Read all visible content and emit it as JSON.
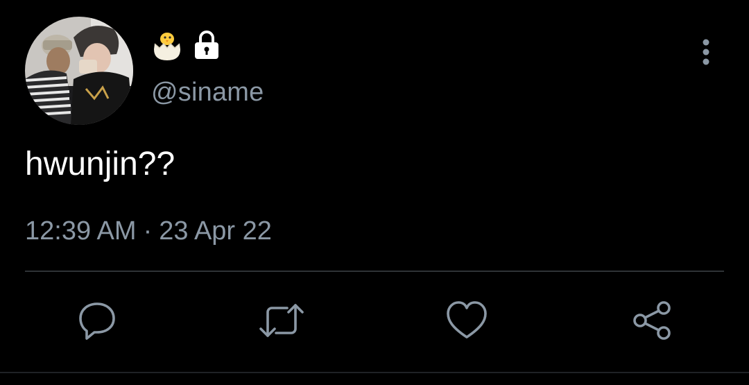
{
  "author": {
    "handle": "@siname",
    "name_badges": [
      "hatching-chick-icon",
      "lock-icon"
    ]
  },
  "tweet": {
    "text": "hwunjin??",
    "time": "12:39 AM",
    "separator": "·",
    "date": "23 Apr 22"
  },
  "actions": [
    "reply-icon",
    "retweet-icon",
    "like-icon",
    "share-icon"
  ],
  "colors": {
    "background": "#000000",
    "text_primary": "#ffffff",
    "text_secondary": "#8b98a5",
    "divider": "#2f3336"
  }
}
